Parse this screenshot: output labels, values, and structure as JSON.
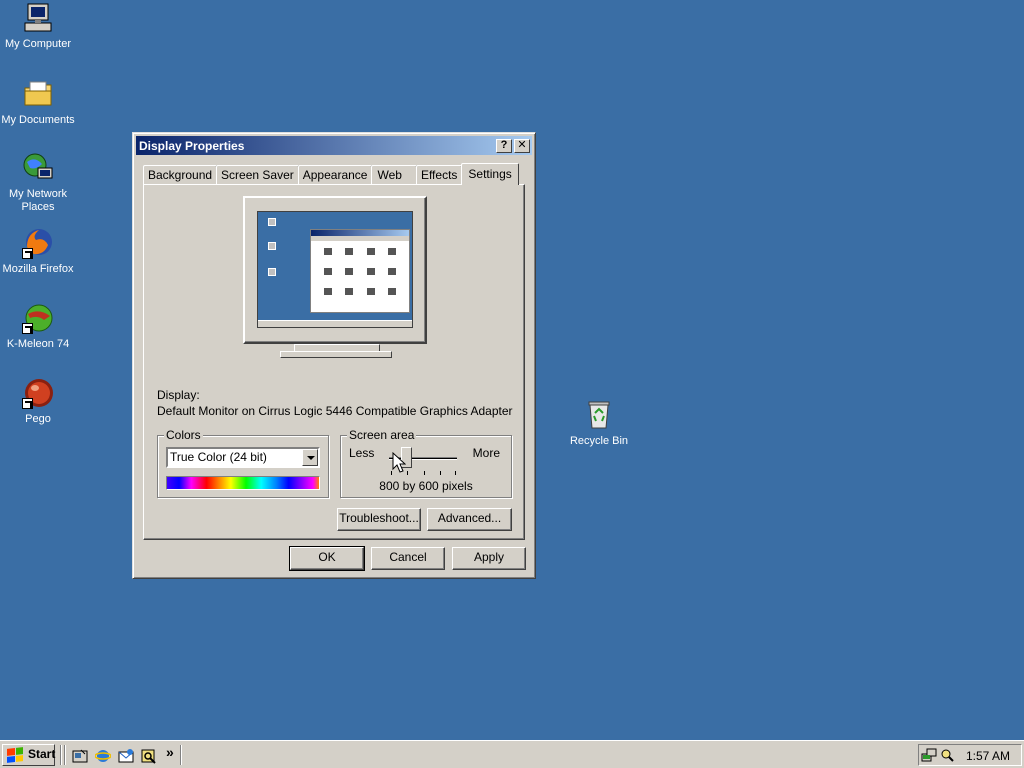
{
  "desktop": {
    "icons": [
      {
        "label_line1": "My Computer",
        "label_line2": ""
      },
      {
        "label_line1": "My Documents",
        "label_line2": ""
      },
      {
        "label_line1": "My Network",
        "label_line2": "Places"
      },
      {
        "label_line1": "Mozilla Firefox",
        "label_line2": ""
      },
      {
        "label_line1": "K-Meleon 74",
        "label_line2": ""
      },
      {
        "label_line1": "Pego",
        "label_line2": ""
      },
      {
        "label_line1": "Recycle Bin",
        "label_line2": ""
      }
    ]
  },
  "dialog": {
    "title": "Display Properties",
    "help_glyph": "?",
    "close_glyph": "✕",
    "tabs": [
      "Background",
      "Screen Saver",
      "Appearance",
      "Web",
      "Effects",
      "Settings"
    ],
    "active_tab": "Settings",
    "display_label": "Display:",
    "display_value": "Default Monitor on Cirrus Logic 5446 Compatible Graphics Adapter",
    "colors": {
      "legend": "Colors",
      "selected": "True Color (24 bit)"
    },
    "screen_area": {
      "legend": "Screen area",
      "less_label": "Less",
      "more_label": "More",
      "value_text": "800 by 600 pixels"
    },
    "buttons": {
      "troubleshoot": "Troubleshoot...",
      "advanced": "Advanced...",
      "ok": "OK",
      "cancel": "Cancel",
      "apply": "Apply"
    }
  },
  "taskbar": {
    "start_label": "Start",
    "chevron": "»",
    "clock": "1:57 AM"
  },
  "colors": {
    "desktop": "#3a6ea5",
    "face": "#d4d0c8",
    "title_start": "#0a246a",
    "title_end": "#a6caf0"
  }
}
